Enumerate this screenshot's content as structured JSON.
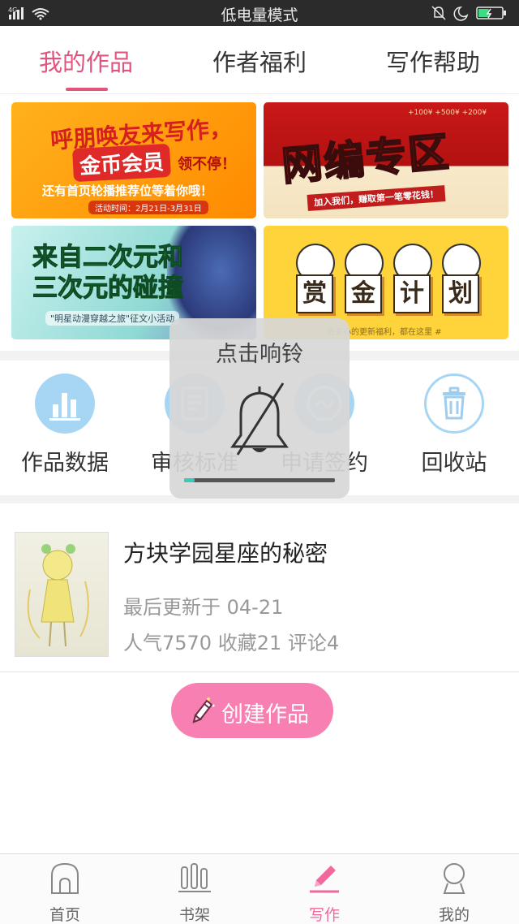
{
  "status_bar": {
    "network": "4G",
    "mode_text": "低电量模式",
    "battery_level": 0.45
  },
  "tabs": [
    {
      "label": "我的作品",
      "active": true
    },
    {
      "label": "作者福利",
      "active": false
    },
    {
      "label": "写作帮助",
      "active": false
    }
  ],
  "banners": {
    "b1": {
      "line1": "呼朋唤友来写作，",
      "line2": "金币会员",
      "line2_side": "领不停！",
      "line3": "还有首页轮播推荐位等着你哦！",
      "date": "活动时间：2月21日-3月31日"
    },
    "b2": {
      "title": "网编专区",
      "coins": "+100¥  +500¥  +200¥",
      "sub": "加入我们，赚取第一笔零花钱！"
    },
    "b3": {
      "title_line1": "来自二次元和",
      "title_line2": "三次元的碰撞",
      "sub": "\"明星动漫穿越之旅\"征文小活动"
    },
    "b4": {
      "chars": [
        "赏",
        "金",
        "计",
        "划"
      ],
      "sub": "最关心的更新福利，都在这里 #"
    }
  },
  "tools": [
    {
      "label": "作品数据",
      "icon": "bar-chart-icon"
    },
    {
      "label": "审核标准",
      "icon": "document-icon"
    },
    {
      "label": "申请签约",
      "icon": "sign-icon"
    },
    {
      "label": "回收站",
      "icon": "trash-icon"
    }
  ],
  "work": {
    "title": "方块学园星座的秘密",
    "updated": "最后更新于 04-21",
    "stats": "人气7570 收藏21 评论4"
  },
  "create_button": {
    "label": "创建作品"
  },
  "bottom_nav": [
    {
      "label": "首页",
      "icon": "home-icon",
      "active": false
    },
    {
      "label": "书架",
      "icon": "bookshelf-icon",
      "active": false
    },
    {
      "label": "写作",
      "icon": "pencil-icon",
      "active": true
    },
    {
      "label": "我的",
      "icon": "profile-icon",
      "active": false
    }
  ],
  "toast": {
    "title": "点击响铃",
    "icon": "bell-muted-icon",
    "progress": 0.07
  },
  "colors": {
    "accent": "#e0547e",
    "nav_active": "#f0689c",
    "create_button": "#f77fb1",
    "tool_circle": "#a7d6f4",
    "toast_progress": "#3cc9b8"
  }
}
